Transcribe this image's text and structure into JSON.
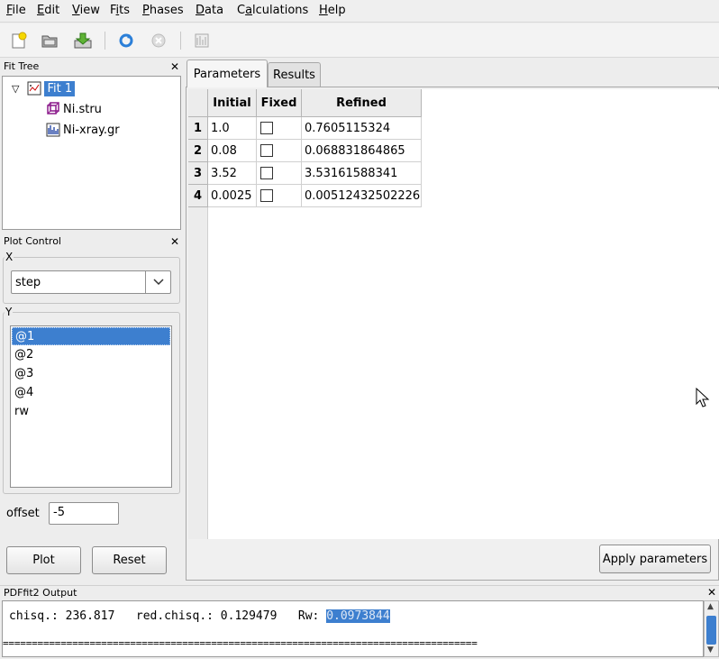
{
  "menu": [
    {
      "label": "File",
      "underline": "F"
    },
    {
      "label": "Edit",
      "underline": "E"
    },
    {
      "label": "View",
      "underline": "V"
    },
    {
      "label": "Fits",
      "underline": "i"
    },
    {
      "label": "Phases",
      "underline": "P"
    },
    {
      "label": "Data",
      "underline": "D"
    },
    {
      "label": "Calculations",
      "underline": "a"
    },
    {
      "label": "Help",
      "underline": "H"
    }
  ],
  "toolbar_icons": [
    "new-project-icon",
    "open-folder-icon",
    "save-download-icon",
    "refresh-icon",
    "stop-icon",
    "plot-icon"
  ],
  "fit_tree": {
    "title": "Fit Tree",
    "root": "Fit 1",
    "children": [
      "Ni.stru",
      "Ni-xray.gr"
    ]
  },
  "plot_control": {
    "title": "Plot Control",
    "x_label": "X",
    "x_value": "step",
    "y_label": "Y",
    "y_items": [
      "@1",
      "@2",
      "@3",
      "@4",
      "rw"
    ],
    "y_selected": "@1",
    "offset_label": "offset",
    "offset_value": "-5",
    "plot_button": "Plot",
    "reset_button": "Reset"
  },
  "tabs": {
    "parameters": "Parameters",
    "results": "Results",
    "active": "Parameters"
  },
  "table": {
    "columns": [
      "Initial",
      "Fixed",
      "Refined"
    ],
    "rows": [
      {
        "index": "1",
        "initial": "1.0",
        "fixed": false,
        "refined": "0.7605115324"
      },
      {
        "index": "2",
        "initial": "0.08",
        "fixed": false,
        "refined": "0.068831864865"
      },
      {
        "index": "3",
        "initial": "3.52",
        "fixed": false,
        "refined": "3.53161588341"
      },
      {
        "index": "4",
        "initial": "0.0025",
        "fixed": false,
        "refined": "0.00512432502226"
      }
    ]
  },
  "apply_button": "Apply parameters",
  "output": {
    "title": "PDFfit2 Output",
    "line1_prefix": "chisq.: 236.817   red.chisq.: 0.129479   Rw: ",
    "line1_highlight": "0.0973844",
    "line2": "=================================================================================="
  },
  "colors": {
    "selection": "#3d7fcf",
    "background": "#ededed"
  }
}
